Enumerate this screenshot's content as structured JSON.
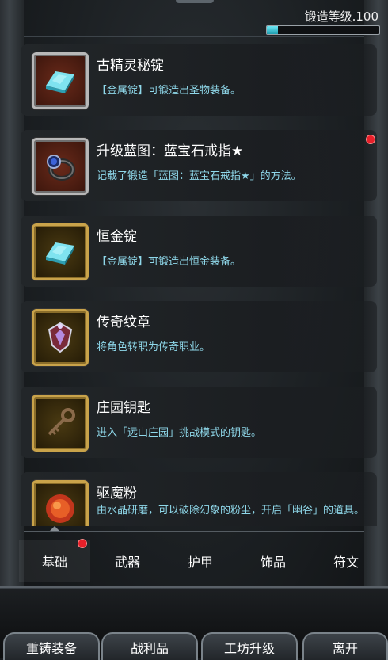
{
  "header": {
    "level_label": "锻造等级.100",
    "level_progress": 0.1
  },
  "items": [
    {
      "title": "古精灵秘锭",
      "desc": "【金属锭】可锻造出圣物装备。",
      "icon": "ingot-icon",
      "frame": "red",
      "badge": false
    },
    {
      "title": "升级蓝图：蓝宝石戒指★",
      "desc": "记载了锻造「蓝图：蓝宝石戒指★」的方法。",
      "icon": "sapphire-ring-icon",
      "frame": "red",
      "badge": true
    },
    {
      "title": "恒金锭",
      "desc": "【金属锭】可锻造出恒金装备。",
      "icon": "ingot-icon",
      "frame": "gold",
      "badge": false
    },
    {
      "title": "传奇纹章",
      "desc": "将角色转职为传奇职业。",
      "icon": "crest-icon",
      "frame": "gold",
      "badge": false
    },
    {
      "title": "庄园钥匙",
      "desc": "进入「远山庄园」挑战模式的钥匙。",
      "icon": "key-icon",
      "frame": "gold",
      "badge": false
    },
    {
      "title": "驱魔粉",
      "desc": "由水晶研磨，可以破除幻象的粉尘，开启「幽谷」的道具。",
      "icon": "powder-icon",
      "frame": "gold",
      "badge": false
    }
  ],
  "tabs": [
    {
      "label": "基础",
      "active": true,
      "badge": true
    },
    {
      "label": "武器",
      "active": false,
      "badge": false
    },
    {
      "label": "护甲",
      "active": false,
      "badge": false
    },
    {
      "label": "饰品",
      "active": false,
      "badge": false
    },
    {
      "label": "符文",
      "active": false,
      "badge": false
    }
  ],
  "buttons": [
    {
      "label": "重铸装备"
    },
    {
      "label": "战利品"
    },
    {
      "label": "工坊升级"
    },
    {
      "label": "离开"
    }
  ],
  "colors": {
    "accent_cyan": "#8fd8ea",
    "badge_red": "#e8202a",
    "progress_fill": "#4fd3e4"
  }
}
